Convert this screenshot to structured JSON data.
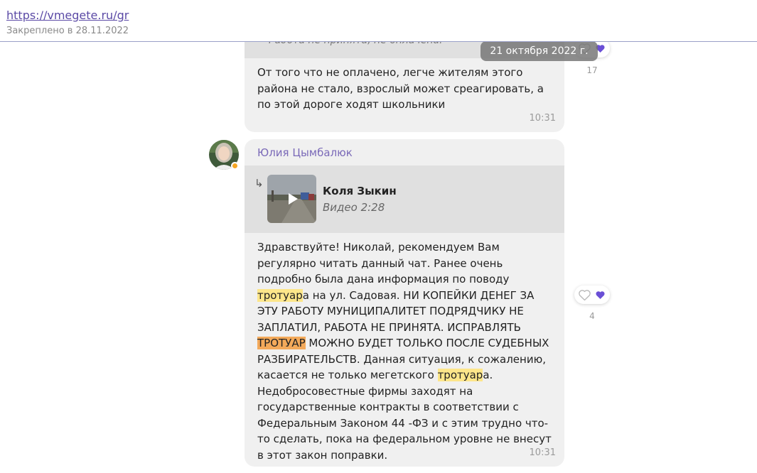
{
  "pinned": {
    "link": "https://vmegete.ru/gr",
    "date": "Закреплено в 28.11.2022"
  },
  "date_pill": "21 октября 2022 г.",
  "message1": {
    "quote": "Работа не принята, не оплачена.",
    "text": "От того что не оплачено, легче жителям этого района не стало, взрослый может среагировать, а по этой дороге ходят школьники",
    "time": "10:31",
    "reactions_count": "17"
  },
  "message2": {
    "author": "Юлия Цымбалюк",
    "forward": {
      "author": "Коля Зыкин",
      "subtitle": "Видео 2:28"
    },
    "text_parts": [
      "Здравствуйте! Николай, рекомендуем Вам регулярно читать данный чат. Ранее очень подробно была дана информация по поводу ",
      "тротуар",
      "а на ул. Садовая. НИ КОПЕЙКИ ДЕНЕГ ЗА ЭТУ РАБОТУ МУНИЦИПАЛИТЕТ ПОДРЯДЧИКУ НЕ ЗАПЛАТИЛ, РАБОТА НЕ ПРИНЯТА. ИСПРАВЛЯТЬ ",
      "ТРОТУАР",
      " МОЖНО БУДЕТ ТОЛЬКО ПОСЛЕ СУДЕБНЫХ РАЗБИРАТЕЛЬСТВ. Данная ситуация, к сожалению, касается не только мегетского ",
      "тротуар",
      "а. Недобросовестные фирмы заходят на государственные контракты в соответствии с Федеральным Законом 44 -ФЗ и с этим трудно что-то сделать, пока на федеральном уровне не внесут в этот закон поправки."
    ],
    "time": "10:31",
    "reactions_count": "4"
  },
  "icons": {
    "like": "heart-outline-icon",
    "favorite": "heart-filled-icon",
    "forward": "forward-arrow-icon",
    "play": "play-icon",
    "online_badge": "online-badge-icon"
  },
  "colors": {
    "accent": "#6a4fd6",
    "author_name": "#7b6ab8",
    "link": "#5b4aa6",
    "search_highlight": "#fde68a",
    "search_highlight_active": "#f3a95a",
    "bubble_bg": "#f0f0f0",
    "online_badge": "#f5a623"
  }
}
